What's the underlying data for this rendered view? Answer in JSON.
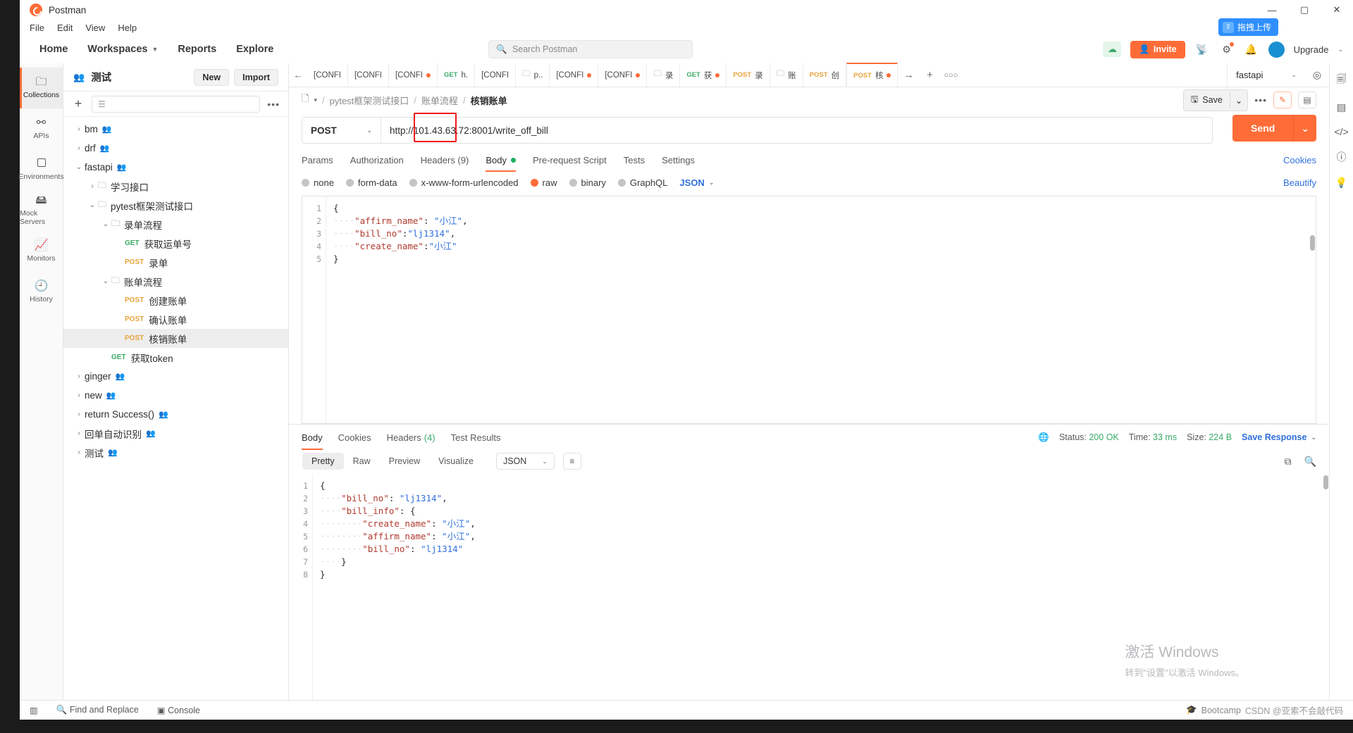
{
  "window": {
    "title": "Postman",
    "minimize": "—",
    "maximize": "▢",
    "close": "✕"
  },
  "menubar": [
    "File",
    "Edit",
    "View",
    "Help"
  ],
  "nav": {
    "items": [
      "Home",
      "Workspaces",
      "Reports",
      "Explore"
    ],
    "search_placeholder": "Search Postman",
    "invite_label": "Invite",
    "upgrade_label": "Upgrade",
    "avatar_initial": "",
    "float_button": "拖拽上传"
  },
  "rail": [
    {
      "label": "Collections",
      "icon": "collections-icon",
      "active": true
    },
    {
      "label": "APIs",
      "icon": "apis-icon",
      "active": false
    },
    {
      "label": "Environments",
      "icon": "environments-icon",
      "active": false
    },
    {
      "label": "Mock Servers",
      "icon": "mock-servers-icon",
      "active": false
    },
    {
      "label": "Monitors",
      "icon": "monitors-icon",
      "active": false
    },
    {
      "label": "History",
      "icon": "history-icon",
      "active": false
    }
  ],
  "workspace": {
    "name": "测试",
    "new_label": "New",
    "import_label": "Import"
  },
  "collections_filter": {
    "placeholder": ""
  },
  "tree": [
    {
      "indent": 0,
      "twist": "›",
      "label": "bm",
      "shared": true
    },
    {
      "indent": 0,
      "twist": "›",
      "label": "drf",
      "shared": true
    },
    {
      "indent": 0,
      "twist": "⌄",
      "label": "fastapi",
      "shared": true
    },
    {
      "indent": 1,
      "twist": "›",
      "folder": true,
      "label": "学习接口"
    },
    {
      "indent": 1,
      "twist": "⌄",
      "folder": true,
      "label": "pytest框架测试接口"
    },
    {
      "indent": 2,
      "twist": "⌄",
      "folder": true,
      "label": "录单流程"
    },
    {
      "indent": 3,
      "twist": "",
      "method": "GET",
      "label": "获取运单号"
    },
    {
      "indent": 3,
      "twist": "",
      "method": "POST",
      "label": "录单"
    },
    {
      "indent": 2,
      "twist": "⌄",
      "folder": true,
      "label": "账单流程"
    },
    {
      "indent": 3,
      "twist": "",
      "method": "POST",
      "label": "创建账单"
    },
    {
      "indent": 3,
      "twist": "",
      "method": "POST",
      "label": "确认账单"
    },
    {
      "indent": 3,
      "twist": "",
      "method": "POST",
      "label": "核销账单",
      "selected": true
    },
    {
      "indent": 2,
      "twist": "",
      "method": "GET",
      "label": "获取token"
    },
    {
      "indent": 0,
      "twist": "›",
      "label": "ginger",
      "shared": true
    },
    {
      "indent": 0,
      "twist": "›",
      "label": "new",
      "shared": true
    },
    {
      "indent": 0,
      "twist": "›",
      "label": "return Success()",
      "shared": true
    },
    {
      "indent": 0,
      "twist": "›",
      "label": "回单自动识别",
      "shared": true
    },
    {
      "indent": 0,
      "twist": "›",
      "label": "测试",
      "shared": true
    }
  ],
  "open_tabs": [
    {
      "label": "[CONFI",
      "dirty": false
    },
    {
      "label": "[CONFI",
      "dirty": false
    },
    {
      "label": "[CONFI",
      "dirty": true
    },
    {
      "method": "GET",
      "label": "h.",
      "dirty": false
    },
    {
      "label": "[CONFI",
      "dirty": false
    },
    {
      "folder": true,
      "label": "p..",
      "dirty": false
    },
    {
      "label": "[CONFI",
      "dirty": true
    },
    {
      "label": "[CONFI",
      "dirty": true
    },
    {
      "folder": true,
      "label": "录",
      "dirty": false
    },
    {
      "method": "GET",
      "label": "获",
      "dirty": true
    },
    {
      "method": "POST",
      "label": "录",
      "dirty": false
    },
    {
      "folder": true,
      "label": "账",
      "dirty": false
    },
    {
      "method": "POST",
      "label": "创",
      "dirty": false
    },
    {
      "method": "POST",
      "label": "核",
      "dirty": true,
      "active": true
    }
  ],
  "environment": {
    "selected": "fastapi"
  },
  "breadcrumb": {
    "parts": [
      "pytest框架测试接口",
      "账单流程"
    ],
    "current": "核销账单"
  },
  "request": {
    "method": "POST",
    "url": "http://101.43.63.72:8001/write_off_bill",
    "send_label": "Send",
    "save_label": "Save",
    "tabs": [
      {
        "label": "Params",
        "active": false
      },
      {
        "label": "Authorization",
        "active": false
      },
      {
        "label": "Headers (9)",
        "active": false
      },
      {
        "label": "Body",
        "active": true,
        "dot": true
      },
      {
        "label": "Pre-request Script",
        "active": false
      },
      {
        "label": "Tests",
        "active": false
      },
      {
        "label": "Settings",
        "active": false
      }
    ],
    "cookies_link": "Cookies",
    "body_types": [
      {
        "label": "none",
        "on": false
      },
      {
        "label": "form-data",
        "on": false
      },
      {
        "label": "x-www-form-urlencoded",
        "on": false
      },
      {
        "label": "raw",
        "on": true
      },
      {
        "label": "binary",
        "on": false
      },
      {
        "label": "GraphQL",
        "on": false
      }
    ],
    "body_format": "JSON",
    "beautify_label": "Beautify",
    "body_lines": [
      {
        "n": 1,
        "text": "{"
      },
      {
        "n": 2,
        "text": "    \"affirm_name\": \"小江\","
      },
      {
        "n": 3,
        "text": "    \"bill_no\":\"lj1314\","
      },
      {
        "n": 4,
        "text": "    \"create_name\":\"小江\""
      },
      {
        "n": 5,
        "text": "}"
      }
    ]
  },
  "response": {
    "tabs": [
      {
        "label": "Body",
        "active": true
      },
      {
        "label": "Cookies",
        "active": false
      },
      {
        "label": "Headers",
        "count": "(4)",
        "active": false
      },
      {
        "label": "Test Results",
        "active": false
      }
    ],
    "status_label": "Status:",
    "status_value": "200 OK",
    "time_label": "Time:",
    "time_value": "33 ms",
    "size_label": "Size:",
    "size_value": "224 B",
    "save_response_label": "Save Response",
    "view_modes": [
      "Pretty",
      "Raw",
      "Preview",
      "Visualize"
    ],
    "view_active": "Pretty",
    "format": "JSON",
    "body_lines": [
      {
        "n": 1,
        "text": "{"
      },
      {
        "n": 2,
        "text": "    \"bill_no\": \"lj1314\","
      },
      {
        "n": 3,
        "text": "    \"bill_info\": {"
      },
      {
        "n": 4,
        "text": "        \"create_name\": \"小江\","
      },
      {
        "n": 5,
        "text": "        \"affirm_name\": \"小江\","
      },
      {
        "n": 6,
        "text": "        \"bill_no\": \"lj1314\""
      },
      {
        "n": 7,
        "text": "    }"
      },
      {
        "n": 8,
        "text": "}"
      }
    ],
    "watermark_line1": "激活 Windows",
    "watermark_line2": "转到\"设置\"以激活 Windows。"
  },
  "footer": {
    "find_replace": "Find and Replace",
    "console": "Console",
    "bootcamp": "Bootcamp",
    "csdn": "CSDN @亚索不会敲代码"
  },
  "colors": {
    "accent": "#ff6c37",
    "link": "#2f6fdd",
    "success": "#3bab68",
    "highlight_box": "#f11a1a"
  }
}
